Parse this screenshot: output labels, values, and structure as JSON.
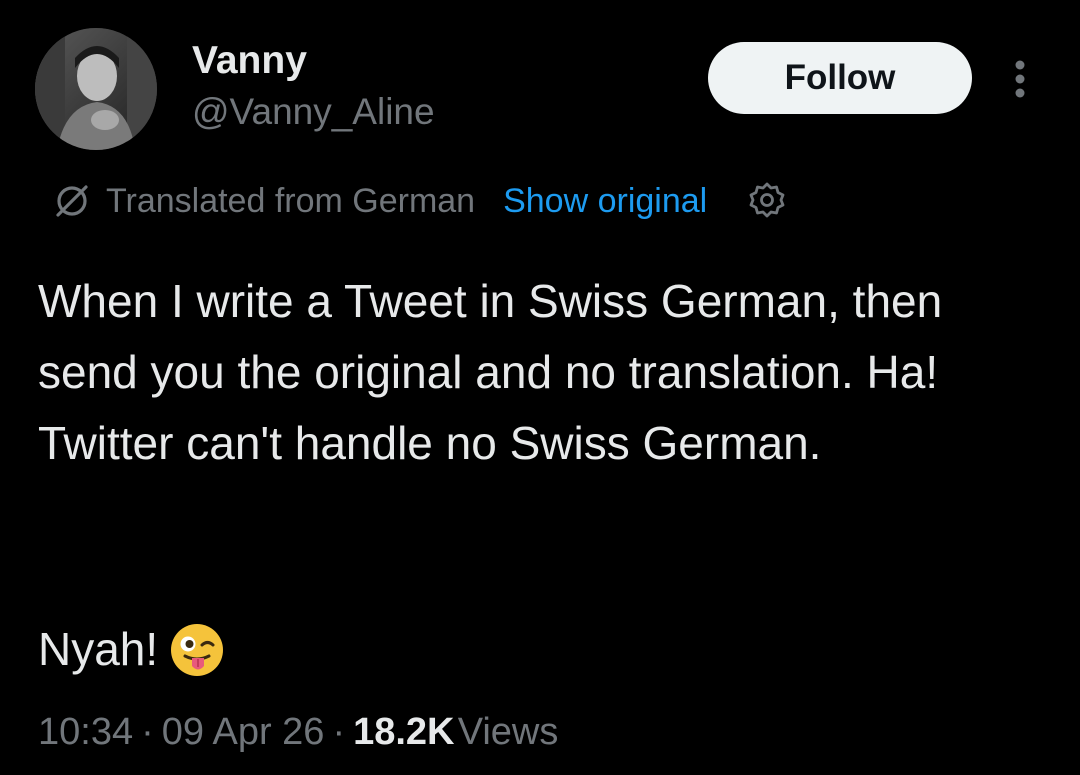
{
  "user": {
    "display_name": "Vanny",
    "handle": "@Vanny_Aline",
    "avatar_icon": "profile-photo"
  },
  "actions": {
    "follow_label": "Follow",
    "more_icon": "more-vertical-icon"
  },
  "translation": {
    "icon": "translate-icon",
    "label": "Translated from German",
    "show_original_label": "Show original",
    "settings_icon": "gear-icon"
  },
  "tweet": {
    "text": "When I write a Tweet in Swiss German, then send you the original and no translation. Ha! Twitter can't handle no Swiss German.",
    "text_line2": "Nyah!",
    "emoji": "winking-face-with-tongue"
  },
  "meta": {
    "time": "10:34",
    "date": "09 Apr 26",
    "separator": "·",
    "views_count": "18.2K",
    "views_label": "Views"
  },
  "colors": {
    "background": "#000000",
    "text_primary": "#e7e9ea",
    "text_secondary": "#71767b",
    "link": "#1d9bf0",
    "follow_bg": "#eff3f4"
  }
}
